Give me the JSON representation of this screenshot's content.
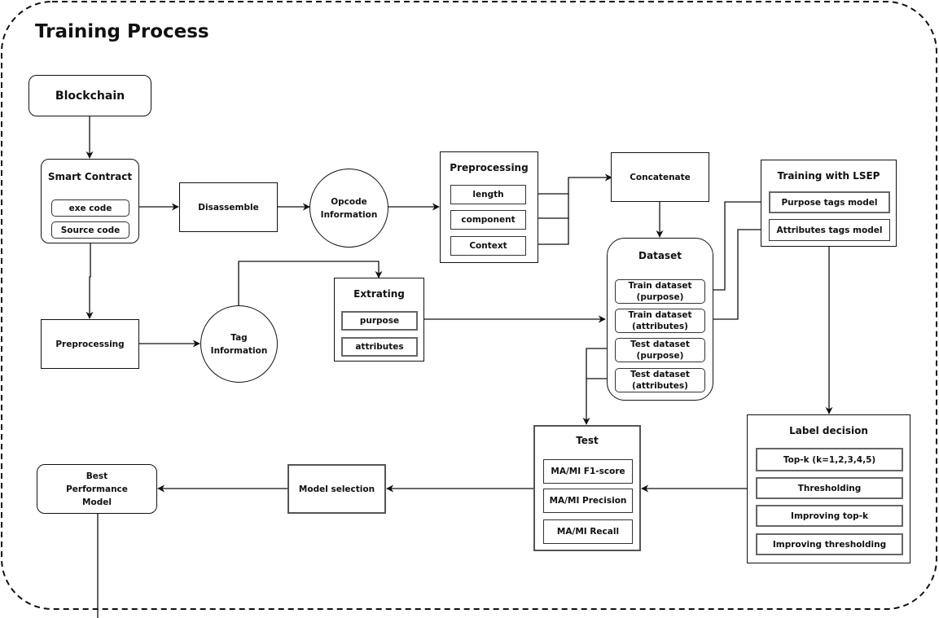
{
  "title": "Training Process",
  "nodes": {
    "blockchain": "Blockchain",
    "smart_contract": {
      "title": "Smart Contract",
      "items": [
        "exe code",
        "Source code"
      ]
    },
    "disassemble": "Disassemble",
    "opcode": [
      "Opcode",
      "Information"
    ],
    "preprocessing_features": {
      "title": "Preprocessing",
      "items": [
        "length",
        "component",
        "Context"
      ]
    },
    "concatenate": "Concatenate",
    "training": {
      "title": "Training with LSEP",
      "items": [
        "Purpose tags model",
        "Attributes tags model"
      ]
    },
    "dataset": {
      "title": "Dataset",
      "items": [
        [
          "Train dataset",
          "(purpose)"
        ],
        [
          "Train dataset",
          "(attributes)"
        ],
        [
          "Test dataset",
          "(purpose)"
        ],
        [
          "Test dataset",
          "(attributes)"
        ]
      ]
    },
    "preprocessing_tags": "Preprocessing",
    "tag_info": [
      "Tag",
      "Information"
    ],
    "extrating": {
      "title": "Extrating",
      "items": [
        "purpose",
        "attributes"
      ]
    },
    "label_decision": {
      "title": "Label decision",
      "items": [
        "Top-k (k=1,2,3,4,5)",
        "Thresholding",
        "Improving  top-k",
        "Improving  thresholding"
      ]
    },
    "test": {
      "title": "Test",
      "items": [
        "MA/MI F1-score",
        "MA/MI Precision",
        "MA/MI Recall"
      ]
    },
    "model_selection": "Model selection",
    "best_model": [
      "Best",
      "Performance",
      "Model"
    ]
  }
}
